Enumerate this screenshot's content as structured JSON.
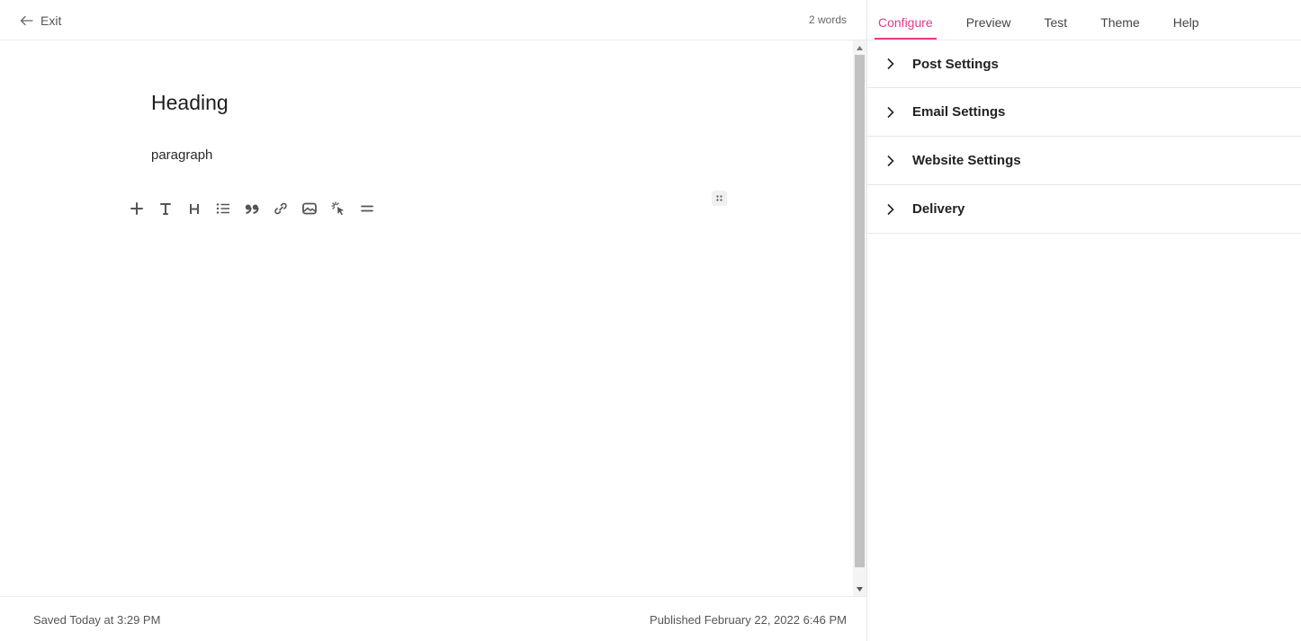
{
  "editor": {
    "exit_label": "Exit",
    "word_count": "2 words",
    "heading": "Heading",
    "paragraph": "paragraph",
    "toolbar": [
      {
        "name": "add-block-button",
        "icon": "plus-icon"
      },
      {
        "name": "text-block-button",
        "icon": "text-icon"
      },
      {
        "name": "heading-block-button",
        "icon": "heading-icon"
      },
      {
        "name": "list-block-button",
        "icon": "list-icon"
      },
      {
        "name": "quote-block-button",
        "icon": "quote-icon"
      },
      {
        "name": "link-block-button",
        "icon": "link-icon"
      },
      {
        "name": "image-block-button",
        "icon": "image-icon"
      },
      {
        "name": "button-block-button",
        "icon": "cursor-click-icon"
      },
      {
        "name": "divider-block-button",
        "icon": "divider-icon"
      }
    ],
    "footer": {
      "saved": "Saved Today at 3:29 PM",
      "published": "Published February 22, 2022 6:46 PM"
    }
  },
  "settings": {
    "tabs": [
      {
        "label": "Configure",
        "active": true
      },
      {
        "label": "Preview",
        "active": false
      },
      {
        "label": "Test",
        "active": false
      },
      {
        "label": "Theme",
        "active": false
      },
      {
        "label": "Help",
        "active": false
      }
    ],
    "sections": [
      {
        "label": "Post Settings"
      },
      {
        "label": "Email Settings"
      },
      {
        "label": "Website Settings"
      },
      {
        "label": "Delivery"
      }
    ]
  },
  "colors": {
    "accent": "#e2398c",
    "text": "#222222",
    "muted": "#555555",
    "border": "#ececec"
  }
}
